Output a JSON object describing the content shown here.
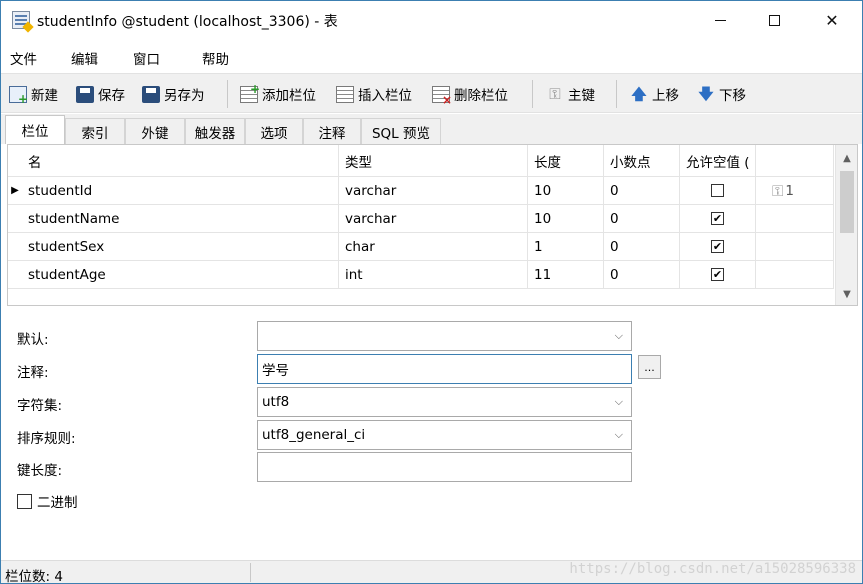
{
  "window": {
    "title": "studentInfo @student (localhost_3306) - 表",
    "min_glyph": "—",
    "max_glyph": "☐",
    "close_glyph": "✕"
  },
  "menu": [
    "文件",
    "编辑",
    "窗口",
    "帮助"
  ],
  "toolbar": {
    "new": "新建",
    "save": "保存",
    "save_as": "另存为",
    "add_field": "添加栏位",
    "insert_field": "插入栏位",
    "delete_field": "删除栏位",
    "primary_key": "主键",
    "move_up": "上移",
    "move_down": "下移"
  },
  "tabs": [
    "栏位",
    "索引",
    "外键",
    "触发器",
    "选项",
    "注释",
    "SQL 预览"
  ],
  "grid": {
    "headers": [
      "名",
      "类型",
      "长度",
      "小数点",
      "允许空值 ("
    ],
    "rows": [
      {
        "name": "studentId",
        "type": "varchar",
        "length": "10",
        "decimals": "0",
        "nullable": false,
        "key": "1",
        "current": true
      },
      {
        "name": "studentName",
        "type": "varchar",
        "length": "10",
        "decimals": "0",
        "nullable": true,
        "key": "",
        "current": false
      },
      {
        "name": "studentSex",
        "type": "char",
        "length": "1",
        "decimals": "0",
        "nullable": true,
        "key": "",
        "current": false
      },
      {
        "name": "studentAge",
        "type": "int",
        "length": "11",
        "decimals": "0",
        "nullable": true,
        "key": "",
        "current": false
      }
    ]
  },
  "props": {
    "default_label": "默认:",
    "default_value": "",
    "comment_label": "注释:",
    "comment_value": "学号",
    "charset_label": "字符集:",
    "charset_value": "utf8",
    "collation_label": "排序规则:",
    "collation_value": "utf8_general_ci",
    "key_length_label": "键长度:",
    "key_length_value": "",
    "binary_label": "二进制",
    "ellipsis": "..."
  },
  "status": {
    "field_count": "栏位数: 4"
  },
  "watermark": "https://blog.csdn.net/a15028596338",
  "colors": {
    "accent": "#3c7fb1",
    "toolbar_bg": "#f0f0f0",
    "arrow_blue": "#2d6fc4"
  }
}
